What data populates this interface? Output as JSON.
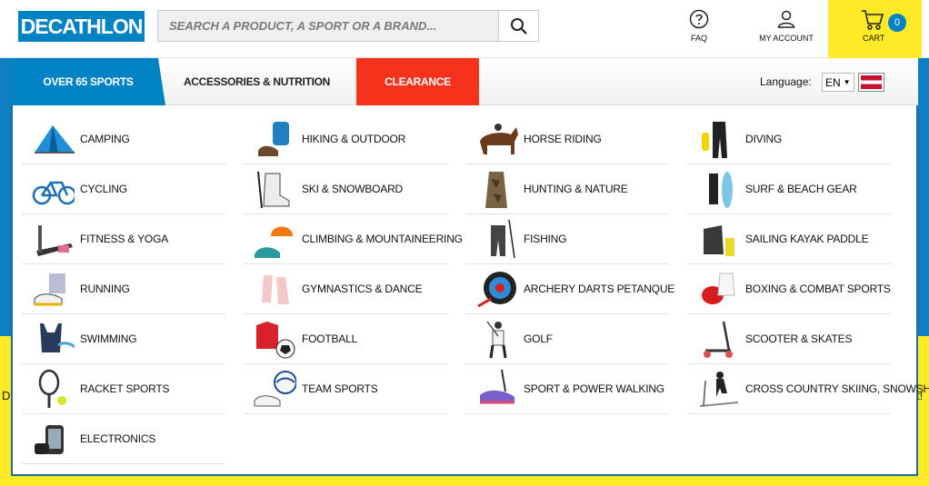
{
  "header": {
    "logo_text": "DECATHLON",
    "search_placeholder": "SEARCH A PRODUCT, A SPORT OR A BRAND...",
    "faq_label": "FAQ",
    "account_label": "MY ACCOUNT",
    "cart_label": "CART",
    "cart_count": "0"
  },
  "nav": {
    "tabs": [
      {
        "label": "OVER 65 SPORTS"
      },
      {
        "label": "ACCESSORIES & NUTRITION"
      },
      {
        "label": "CLEARANCE"
      }
    ],
    "language_label": "Language:",
    "language_value": "EN"
  },
  "menu": {
    "col1": [
      {
        "label": "CAMPING",
        "icon": "tent-icon"
      },
      {
        "label": "CYCLING",
        "icon": "bicycle-icon"
      },
      {
        "label": "FITNESS & YOGA",
        "icon": "treadmill-icon"
      },
      {
        "label": "RUNNING",
        "icon": "running-shoe-icon"
      },
      {
        "label": "SWIMMING",
        "icon": "swimsuit-icon"
      },
      {
        "label": "RACKET SPORTS",
        "icon": "racket-icon"
      },
      {
        "label": "ELECTRONICS",
        "icon": "gps-watch-icon"
      }
    ],
    "col2": [
      {
        "label": "HIKING & OUTDOOR",
        "icon": "backpack-icon"
      },
      {
        "label": "SKI & SNOWBOARD",
        "icon": "ski-boot-icon"
      },
      {
        "label": "CLIMBING & MOUNTAINEERING",
        "icon": "helmet-icon"
      },
      {
        "label": "GYMNASTICS & DANCE",
        "icon": "ballet-shoe-icon"
      },
      {
        "label": "FOOTBALL",
        "icon": "football-icon"
      },
      {
        "label": "TEAM SPORTS",
        "icon": "volleyball-icon"
      }
    ],
    "col3": [
      {
        "label": "HORSE RIDING",
        "icon": "horse-icon"
      },
      {
        "label": "HUNTING & NATURE",
        "icon": "camouflage-icon"
      },
      {
        "label": "FISHING",
        "icon": "fishing-waders-icon"
      },
      {
        "label": "ARCHERY DARTS PETANQUE",
        "icon": "dartboard-icon"
      },
      {
        "label": "GOLF",
        "icon": "golfer-icon"
      },
      {
        "label": "SPORT & POWER WALKING",
        "icon": "walking-shoe-icon"
      }
    ],
    "col4": [
      {
        "label": "DIVING",
        "icon": "diving-suit-icon"
      },
      {
        "label": "SURF & BEACH GEAR",
        "icon": "surfboard-icon"
      },
      {
        "label": "SAILING KAYAK PADDLE",
        "icon": "sailing-jacket-icon"
      },
      {
        "label": "BOXING & COMBAT SPORTS",
        "icon": "boxing-gloves-icon"
      },
      {
        "label": "SCOOTER & SKATES",
        "icon": "scooter-icon"
      },
      {
        "label": "CROSS COUNTRY SKIING, SNOWSHOES",
        "icon": "cross-country-skier-icon"
      }
    ]
  },
  "colors": {
    "brand_blue": "#0082c3",
    "clearance_red": "#f5331d",
    "cart_yellow": "#ffea28"
  }
}
